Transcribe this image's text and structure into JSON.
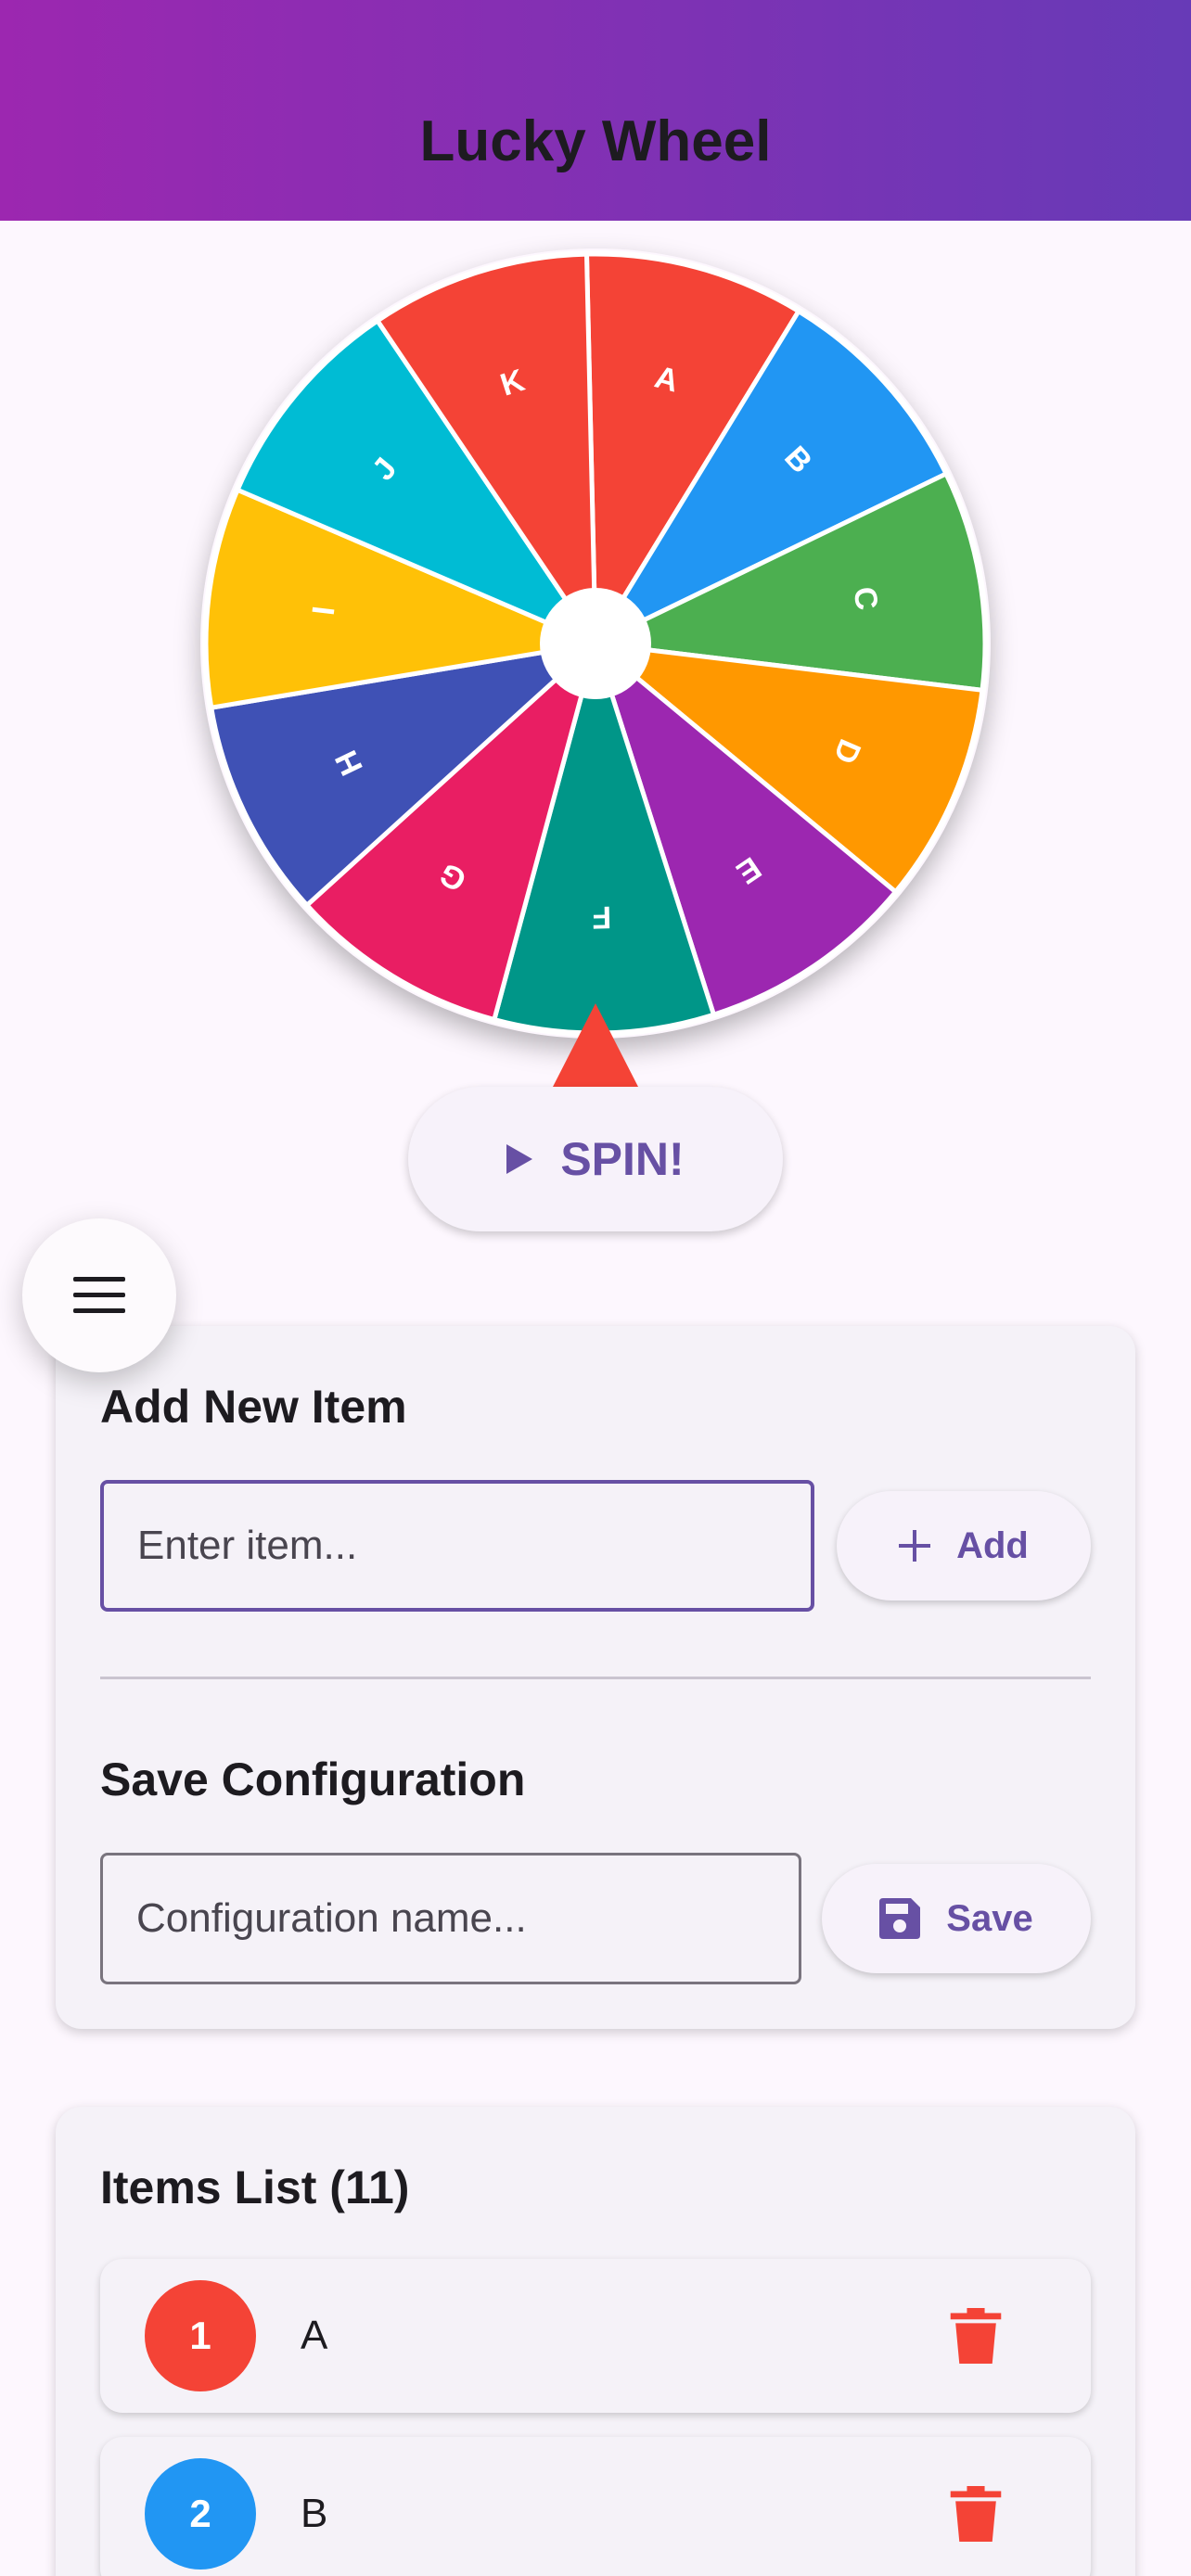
{
  "app_bar": {
    "title": "Lucky Wheel"
  },
  "wheel": {
    "segments": [
      {
        "label": "A",
        "color": "#F44336"
      },
      {
        "label": "B",
        "color": "#2196F3"
      },
      {
        "label": "C",
        "color": "#4CAF50"
      },
      {
        "label": "D",
        "color": "#FF9800"
      },
      {
        "label": "E",
        "color": "#9C27B0"
      },
      {
        "label": "F",
        "color": "#009688"
      },
      {
        "label": "G",
        "color": "#E91E63"
      },
      {
        "label": "H",
        "color": "#3F51B5"
      },
      {
        "label": "I",
        "color": "#FFC107"
      },
      {
        "label": "J",
        "color": "#00BCD4"
      },
      {
        "label": "K",
        "color": "#F44336"
      }
    ],
    "pointer_color": "#F44336"
  },
  "spin_button": {
    "label": "SPIN!",
    "icon": "play-icon"
  },
  "menu_button": {
    "icon": "menu-icon"
  },
  "add_section": {
    "title": "Add New Item",
    "input_placeholder": "Enter item...",
    "button_label": "Add",
    "button_icon": "plus-icon"
  },
  "save_section": {
    "title": "Save Configuration",
    "input_placeholder": "Configuration name...",
    "button_label": "Save",
    "button_icon": "save-icon"
  },
  "items_list": {
    "title": "Items List (11)",
    "items": [
      {
        "number": "1",
        "name": "A",
        "color": "#F44336"
      },
      {
        "number": "2",
        "name": "B",
        "color": "#2196F3"
      }
    ],
    "delete_icon": "trash-icon",
    "delete_color": "#F44336"
  },
  "colors": {
    "accent": "#6750A4",
    "appbar_gradient": [
      "#9C27B0",
      "#673AB7"
    ]
  }
}
